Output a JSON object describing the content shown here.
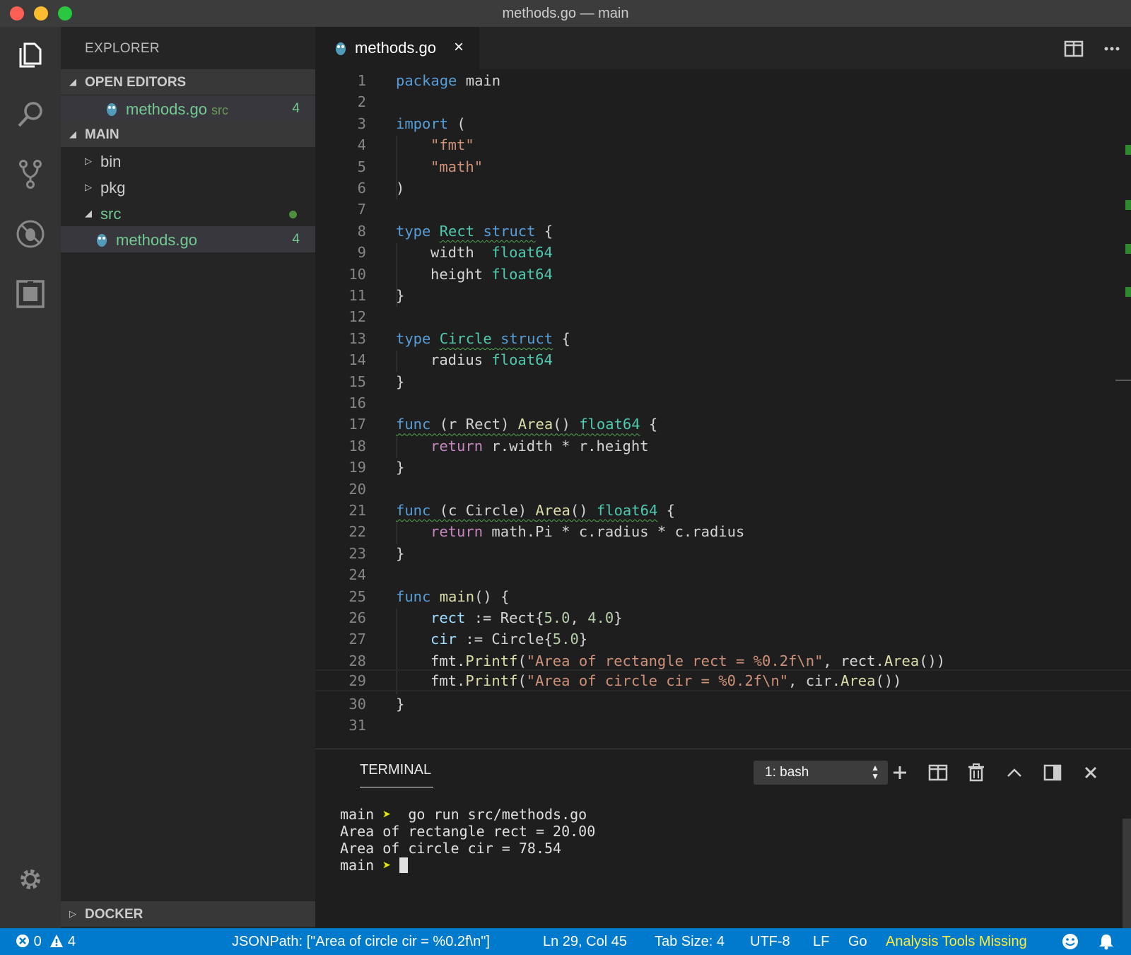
{
  "window": {
    "title": "methods.go — main"
  },
  "sidebar": {
    "title": "EXPLORER",
    "open_editors": {
      "label": "OPEN EDITORS",
      "items": [
        {
          "name": "methods.go",
          "folder": "src",
          "badge": "4"
        }
      ]
    },
    "main": {
      "label": "MAIN",
      "items": [
        {
          "name": "bin"
        },
        {
          "name": "pkg"
        },
        {
          "name": "src"
        },
        {
          "name": "methods.go",
          "badge": "4"
        }
      ]
    },
    "docker": {
      "label": "DOCKER"
    }
  },
  "editor": {
    "tab": {
      "label": "methods.go",
      "close": "×"
    },
    "line_numbers": [
      "1",
      "2",
      "3",
      "4",
      "5",
      "6",
      "7",
      "8",
      "9",
      "10",
      "11",
      "12",
      "13",
      "14",
      "15",
      "16",
      "17",
      "18",
      "19",
      "20",
      "21",
      "22",
      "23",
      "24",
      "25",
      "26",
      "27",
      "28",
      "29",
      "30",
      "31"
    ],
    "code": {
      "l1_kw": "package",
      "l1_rest": " main",
      "l3_kw": "import",
      "l3_rest": " (",
      "l4": "\"fmt\"",
      "l5": "\"math\"",
      "l6": ")",
      "l8_kw": "type",
      "l8_name": "Rect",
      "l8_struct": "struct",
      "l8_rest": " {",
      "l9_field": "width",
      "l9_type": "float64",
      "l10_field": "height",
      "l10_type": "float64",
      "l11": "}",
      "l13_kw": "type",
      "l13_name": "Circle",
      "l13_struct": "struct",
      "l13_rest": " {",
      "l14_field": "radius",
      "l14_type": "float64",
      "l15": "}",
      "l17_kw": "func",
      "l17_recv": " (r Rect) ",
      "l17_fn": "Area",
      "l17_paren": "() ",
      "l17_type": "float64",
      "l17_rest": " {",
      "l18_kw": "return",
      "l18_rest": " r.width * r.height",
      "l19": "}",
      "l21_kw": "func",
      "l21_recv": " (c Circle) ",
      "l21_fn": "Area",
      "l21_paren": "() ",
      "l21_type": "float64",
      "l21_rest": " {",
      "l22_kw": "return",
      "l22_rest": " math.Pi * c.radius * c.radius",
      "l23": "}",
      "l25_kw": "func",
      "l25_fn": " main",
      "l25_rest": "() {",
      "l26_var": "rect",
      "l26_op": " := Rect{",
      "l26_n1": "5.0",
      "l26_sep": ", ",
      "l26_n2": "4.0",
      "l26_end": "}",
      "l27_var": "cir",
      "l27_op": " := Circle{",
      "l27_n1": "5.0",
      "l27_end": "}",
      "l28_pre": "fmt.",
      "l28_fn": "Printf",
      "l28_p": "(",
      "l28_str": "\"Area of rectangle rect = %0.2f\\n\"",
      "l28_mid": ", rect.",
      "l28_fn2": "Area",
      "l28_end": "())",
      "l29_pre": "fmt.",
      "l29_fn": "Printf",
      "l29_p": "(",
      "l29_str": "\"Area of circle cir = %0.2f\\n\"",
      "l29_mid": ", cir.",
      "l29_fn2": "Area",
      "l29_end": "())",
      "l30": "}"
    }
  },
  "panel": {
    "title": "TERMINAL",
    "terminal_select": "1: bash",
    "lines": {
      "prompt": "main",
      "arrow": "➤",
      "command": "go run src/methods.go",
      "out1": "Area of rectangle rect = 20.00",
      "out2": "Area of circle cir = 78.54"
    }
  },
  "statusbar": {
    "errors": "0",
    "warnings": "4",
    "jsonpath": "JSONPath: [\"Area of circle cir = %0.2f\\n\"]",
    "position": "Ln 29, Col 45",
    "tab_size": "Tab Size: 4",
    "encoding": "UTF-8",
    "eol": "LF",
    "language": "Go",
    "analysis": "Analysis Tools Missing"
  },
  "colors": {
    "status_bar": "#007acc",
    "keyword": "#569cd6",
    "type": "#4ec9b0",
    "string": "#ce9178",
    "number": "#b5cea8",
    "function": "#dcdcaa",
    "modified_file": "#73c991",
    "warning_text": "#ffeb3b"
  },
  "icons": [
    "files-icon",
    "search-icon",
    "source-control-icon",
    "debug-icon",
    "extensions-icon",
    "gear-icon",
    "go-file-icon",
    "split-editor-icon",
    "more-actions-icon",
    "add-terminal-icon",
    "split-terminal-icon",
    "trash-icon",
    "maximize-panel-icon",
    "panel-position-icon",
    "close-panel-icon",
    "error-icon",
    "warning-icon",
    "smiley-icon",
    "bell-icon"
  ]
}
